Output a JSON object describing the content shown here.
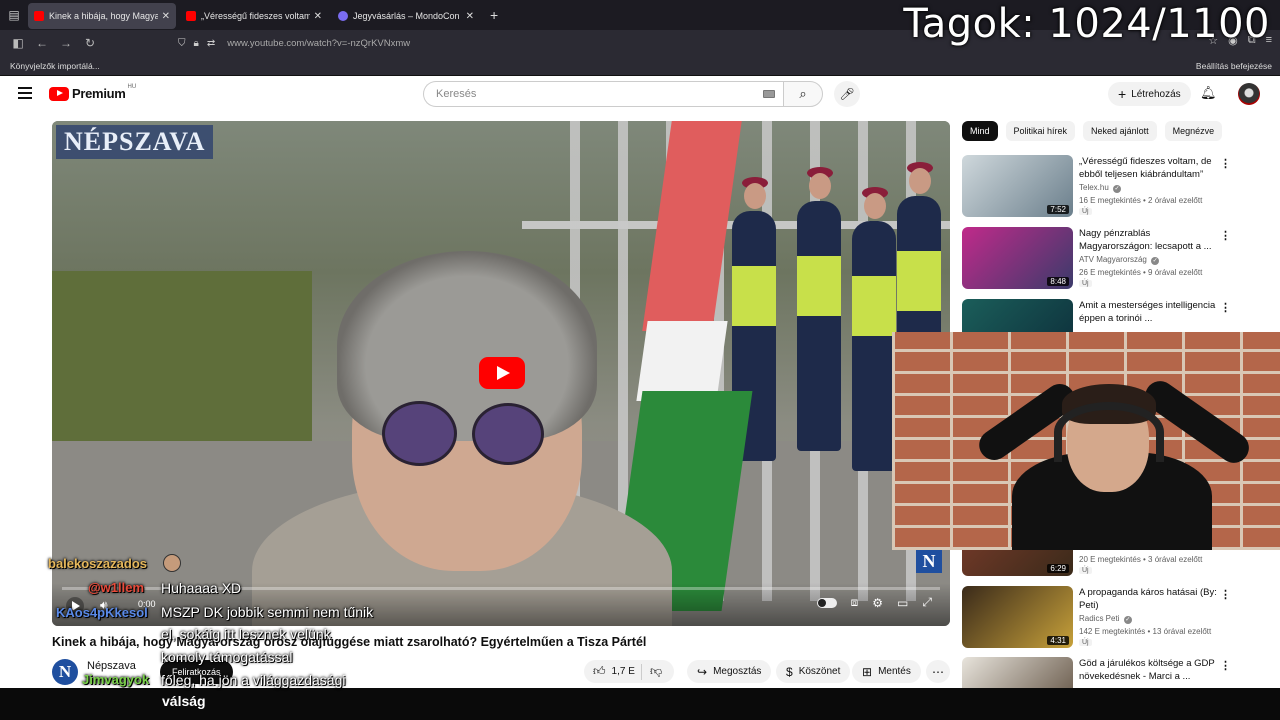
{
  "browser": {
    "tabs": [
      {
        "label": "Kinek a hibája, hogy Magyaror",
        "active": true,
        "favicon": "youtube-favicon"
      },
      {
        "label": "„Vérességű fideszes voltam, de",
        "active": false,
        "favicon": "youtube-favicon"
      },
      {
        "label": "Jegyvásárlás – MondoCon",
        "active": false,
        "favicon": "mondocon-favicon"
      }
    ],
    "url": "www.youtube.com/watch?v=-nzQrKVNxmw",
    "bookmarks_left": "Könyvjelzők importálá...",
    "bookmarks_right": "Beállítás befejezése"
  },
  "overlay": {
    "members": "Tagok: 1024/1100"
  },
  "youtube": {
    "logo_text": "Premium",
    "logo_region": "HU",
    "search_placeholder": "Keresés",
    "create_label": "Létrehozás"
  },
  "player": {
    "watermark": "NÉPSZAVA",
    "corner_logo": "N",
    "time": "0:00",
    "progress": 0
  },
  "video": {
    "title": "Kinek a hibája, hogy Magyarország orosz olajfüggése miatt zsarolható? Egyértelműen a Tisza Pártél",
    "channel": "Népszava",
    "channel_initial": "N",
    "subscribe_label": "Feliratkozás",
    "likes": "1,7 E",
    "share_label": "Megosztás",
    "thanks_label": "Köszönet",
    "save_label": "Mentés"
  },
  "sidebar": {
    "chips": [
      {
        "label": "Mind",
        "active": true
      },
      {
        "label": "Politikai hírek",
        "active": false
      },
      {
        "label": "Neked ajánlott",
        "active": false
      },
      {
        "label": "Megnézve",
        "active": false
      }
    ],
    "recommendations": [
      {
        "title": "„Vérességű fideszes voltam, de ebből teljesen kiábrándultam”",
        "channel": "Telex.hu",
        "meta": "16 E megtekintés • 2 órával ezelőtt",
        "badge": "Új",
        "duration": "7:52",
        "thumb_colors": [
          "#cfd8dc",
          "#6b7f8c"
        ]
      },
      {
        "title": "Nagy pénzrablás Magyarországon: lecsapott a ...",
        "channel": "ATV Magyarország",
        "meta": "26 E megtekintés • 9 órával ezelőtt",
        "badge": "Új",
        "duration": "8:48",
        "thumb_colors": [
          "#c02a8a",
          "#3b3b6b"
        ]
      },
      {
        "title": "Amit a mesterséges intelligencia éppen a torinói ...",
        "channel": "",
        "meta": "",
        "badge": "",
        "duration": "",
        "thumb_colors": [
          "#1b5e5a",
          "#0d2e3a"
        ]
      },
      {
        "title": "",
        "channel": "",
        "meta": "20 E megtekintés • 3 órával ezelőtt",
        "badge": "Új",
        "duration": "6:29",
        "thumb_colors": [
          "#7a3b2a",
          "#3a2a1a"
        ]
      },
      {
        "title": "A propaganda káros hatásai (By: Peti)",
        "channel": "Radics Peti",
        "meta": "142 E megtekintés • 13 órával ezelőtt",
        "badge": "Új",
        "duration": "4:31",
        "thumb_colors": [
          "#3a2a1a",
          "#c7a13a"
        ]
      },
      {
        "title": "Göd a járulékos költsége a GDP növekedésnek - Marci a ...",
        "channel": "",
        "meta": "",
        "badge": "",
        "duration": "",
        "thumb_colors": [
          "#e8e4dc",
          "#5a4a3a"
        ]
      }
    ]
  },
  "chat": {
    "messages": [
      {
        "user": "balekoszazados",
        "text": "",
        "user_color": "#e6b85c"
      },
      {
        "user": "@w1llem",
        "text": "Huhaaaa XD",
        "user_color": "#e84a3a"
      },
      {
        "user": "KAos4pKkesol",
        "text": "MSZP DK jobbik semmi nem tűnik",
        "user_color": "#5a8ae8"
      },
      {
        "user": "",
        "text": "el, sokáig itt lesznek velünk",
        "user_color": "#ffffff"
      },
      {
        "user": "",
        "text": "komoly támogatással",
        "user_color": "#ffffff"
      },
      {
        "user": "Jimvagyok",
        "text": "főleg, ha jön a világgazdasági",
        "user_color": "#7ad14a"
      },
      {
        "user": "",
        "text": "válság",
        "user_color": "#ffffff"
      }
    ]
  }
}
